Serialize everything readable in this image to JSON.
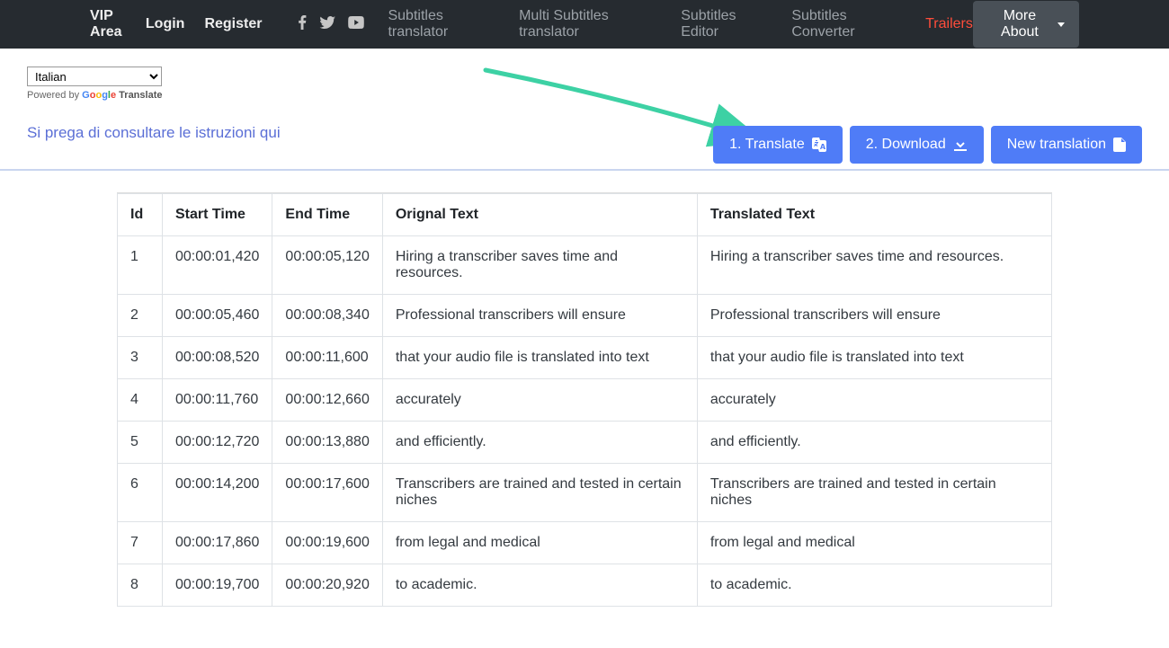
{
  "nav": {
    "vip": "VIP Area",
    "login": "Login",
    "register": "Register",
    "subtitles_translator": "Subtitles translator",
    "multi_subtitles_translator": "Multi Subtitles translator",
    "subtitles_editor": "Subtitles Editor",
    "subtitles_converter": "Subtitles Converter",
    "trailers": "Trailers",
    "more_about": "More About"
  },
  "lang": {
    "selected": "Italian",
    "powered_prefix": "Powered by ",
    "translate_label": "Translate"
  },
  "instructions_link": "Si prega di consultare le istruzioni qui",
  "buttons": {
    "translate": "1. Translate",
    "download": "2. Download",
    "new_translation": "New translation"
  },
  "table": {
    "headers": {
      "id": "Id",
      "start": "Start Time",
      "end": "End Time",
      "orig": "Orignal Text",
      "trans": "Translated Text"
    },
    "rows": [
      {
        "id": "1",
        "start": "00:00:01,420",
        "end": "00:00:05,120",
        "orig": "Hiring a transcriber saves time and resources.",
        "trans": "Hiring a transcriber saves time and resources."
      },
      {
        "id": "2",
        "start": "00:00:05,460",
        "end": "00:00:08,340",
        "orig": "Professional transcribers will ensure",
        "trans": "Professional transcribers will ensure"
      },
      {
        "id": "3",
        "start": "00:00:08,520",
        "end": "00:00:11,600",
        "orig": "that your audio file is translated into text",
        "trans": "that your audio file is translated into text"
      },
      {
        "id": "4",
        "start": "00:00:11,760",
        "end": "00:00:12,660",
        "orig": "accurately",
        "trans": "accurately"
      },
      {
        "id": "5",
        "start": "00:00:12,720",
        "end": "00:00:13,880",
        "orig": "and efficiently.",
        "trans": "and efficiently."
      },
      {
        "id": "6",
        "start": "00:00:14,200",
        "end": "00:00:17,600",
        "orig": "Transcribers are trained and tested in certain niches",
        "trans": "Transcribers are trained and tested in certain niches"
      },
      {
        "id": "7",
        "start": "00:00:17,860",
        "end": "00:00:19,600",
        "orig": "from legal and medical",
        "trans": "from legal and medical"
      },
      {
        "id": "8",
        "start": "00:00:19,700",
        "end": "00:00:20,920",
        "orig": "to academic.",
        "trans": "to academic."
      }
    ]
  }
}
